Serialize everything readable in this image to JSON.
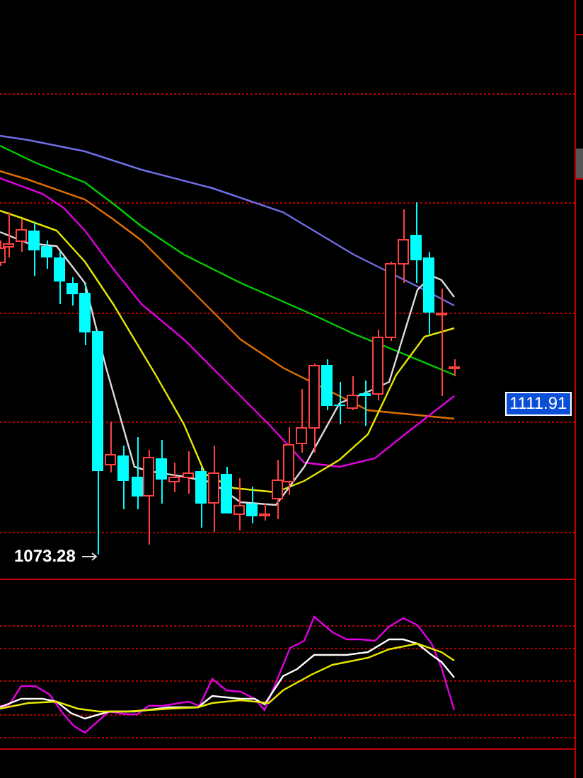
{
  "price_chart": {
    "low_label": "1073.28"
  },
  "price_axis": {
    "current_price": "1111.91"
  }
}
